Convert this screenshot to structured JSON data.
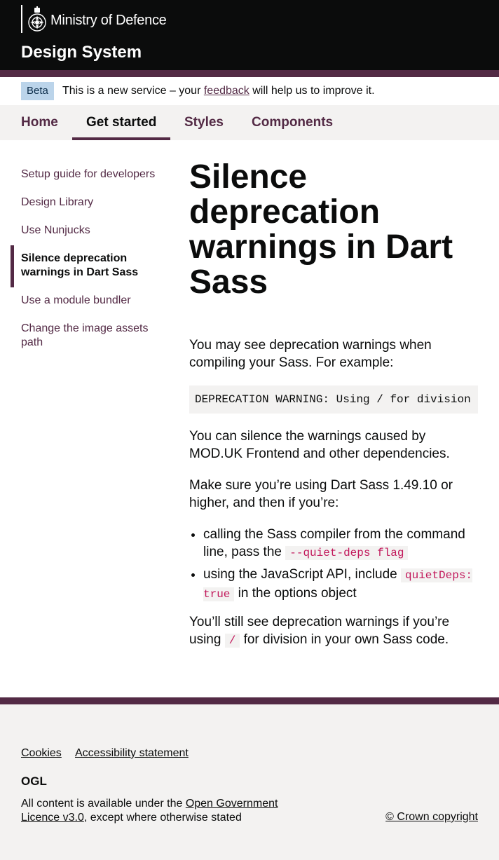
{
  "header": {
    "organisation": "Ministry of Defence",
    "service_name": "Design System"
  },
  "phase_banner": {
    "tag": "Beta",
    "text_before": "This is a new service – your ",
    "link": "feedback",
    "text_after": " will help us to improve it."
  },
  "nav": {
    "items": [
      {
        "label": "Home"
      },
      {
        "label": "Get started",
        "active": true
      },
      {
        "label": "Styles"
      },
      {
        "label": "Components"
      }
    ]
  },
  "sidenav": {
    "items": [
      {
        "label": "Setup guide for developers"
      },
      {
        "label": "Design Library"
      },
      {
        "label": "Use Nunjucks"
      },
      {
        "label": "Silence deprecation warnings in Dart Sass",
        "current": true
      },
      {
        "label": "Use a module bundler"
      },
      {
        "label": "Change the image assets path"
      }
    ]
  },
  "main": {
    "title": "Silence deprecation warnings in Dart Sass",
    "intro": "You may see deprecation warnings when compiling your Sass. For example:",
    "code_example": "DEPRECATION WARNING: Using / for division",
    "para2": "You can silence the warnings caused by MOD.UK Frontend and other dependencies.",
    "para3": "Make sure you’re using Dart Sass 1.49.10 or higher, and then if you’re:",
    "bullets": [
      {
        "text": "calling the Sass compiler from the command line, pass the ",
        "code": "--quiet-deps flag",
        "after": ""
      },
      {
        "text": "using the JavaScript API, include ",
        "code": "quietDeps: true",
        "after": " in the options object"
      }
    ],
    "para4_before": "You’ll still see deprecation warnings if you’re using ",
    "para4_code": "/",
    "para4_after": " for division in your own Sass code."
  },
  "footer": {
    "links": [
      {
        "label": "Cookies"
      },
      {
        "label": "Accessibility statement"
      }
    ],
    "ogl_logo": "OGL",
    "licence_before": "All content is available under the ",
    "licence_link": "Open Government Licence v3.0",
    "licence_after": ", except where otherwise stated",
    "copyright": "© Crown copyright"
  },
  "colors": {
    "brand": "#532a45",
    "header_bg": "#0b0c0c",
    "beta_tag": "#bbd4ea",
    "panel_bg": "#f3f2f1"
  }
}
